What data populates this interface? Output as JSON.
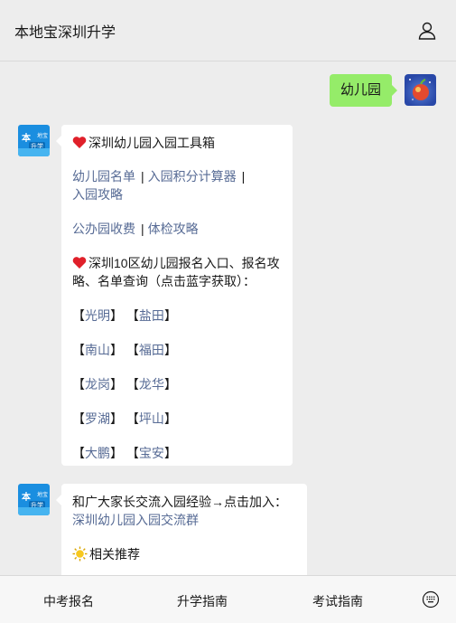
{
  "header": {
    "title": "本地宝深圳升学"
  },
  "user_message": {
    "text": "幼儿园"
  },
  "bot_avatar": {
    "line1": "本",
    "line2": "地宝",
    "line3": "升学"
  },
  "message1": {
    "title": "深圳幼儿园入园工具箱",
    "links_row1": [
      "幼儿园名单",
      "入园积分计算器",
      "入园攻略"
    ],
    "links_row2": [
      "公办园收费",
      "体检攻略"
    ],
    "separator": "|",
    "districts_intro": "深圳10区幼儿园报名入口、报名攻略、名单查询（点击蓝字获取）：",
    "districts": [
      [
        "光明",
        "盐田"
      ],
      [
        "南山",
        "福田"
      ],
      [
        "龙岗",
        "龙华"
      ],
      [
        "罗湖",
        "坪山"
      ],
      [
        "大鹏",
        "宝安"
      ]
    ],
    "bracket_open": "【",
    "bracket_close": "】"
  },
  "message2": {
    "text": "和广大家长交流入园经验→点击加入：",
    "link": "深圳幼儿园入园交流群",
    "recommend": "相关推荐"
  },
  "footer": {
    "tabs": [
      "中考报名",
      "升学指南",
      "考试指南"
    ],
    "keyboard_icon": "keyboard-icon"
  },
  "colors": {
    "link": "#576b95",
    "bubble_green": "#95ec69",
    "background": "#ededed"
  }
}
